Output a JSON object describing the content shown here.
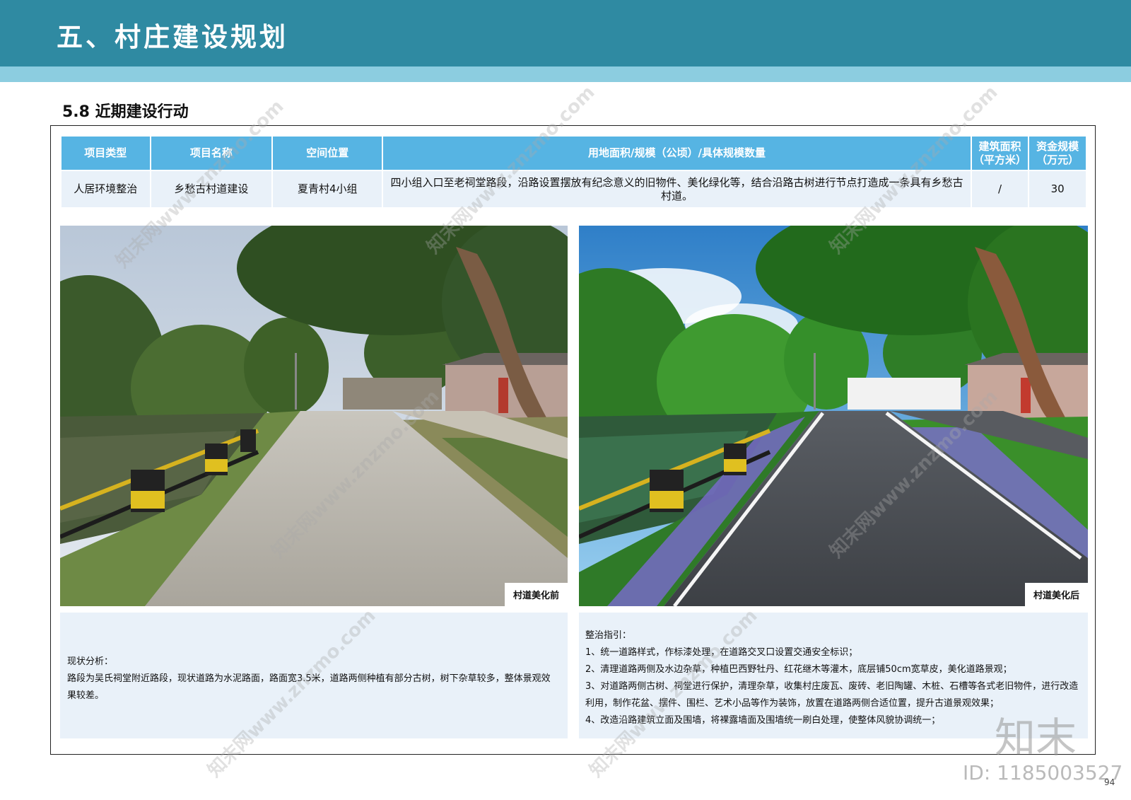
{
  "header": {
    "title": "五、村庄建设规划"
  },
  "section": {
    "title": "5.8 近期建设行动"
  },
  "table": {
    "headers": [
      "项目类型",
      "项目名称",
      "空间位置",
      "用地面积/规模（公顷）/具体规模数量",
      "建筑面积\n（平方米）",
      "资金规模\n（万元）"
    ],
    "rows": [
      [
        "人居环境整治",
        "乡愁古村道建设",
        "夏青村4小组",
        "四小组入口至老祠堂路段，沿路设置摆放有纪念意义的旧物件、美化绿化等，结合沿路古树进行节点打造成一条具有乡愁古村道。",
        "/",
        "30"
      ]
    ]
  },
  "photos": {
    "before_caption": "村道美化前",
    "after_caption": "村道美化后"
  },
  "analysis": {
    "heading": "现状分析：",
    "body": "路段为吴氏祠堂附近路段，现状道路为水泥路面，路面宽3.5米，道路两侧种植有部分古树，树下杂草较多，整体景观效果较差。"
  },
  "guide": {
    "heading": "整治指引：",
    "items": [
      "1、统一道路样式，作标漆处理，在道路交叉口设置交通安全标识；",
      "2、清理道路两侧及水边杂草，种植巴西野牡丹、红花继木等灌木，底层铺50cm宽草皮，美化道路景观；",
      "3、对道路两侧古树、祠堂进行保护，清理杂草，收集村庄废瓦、废砖、老旧陶罐、木桩、石槽等各式老旧物件，进行改造利用，制作花盆、摆件、围栏、艺术小品等作为装饰，放置在道路两侧合适位置，提升古道景观效果；",
      "4、改造沿路建筑立面及围墙，将裸露墙面及围墙统一刷白处理，使整体风貌协调统一；"
    ]
  },
  "watermark": {
    "site": "知末网www.znzmo.com",
    "logo": "知末",
    "id": "ID: 1185003527"
  },
  "page_number": "94",
  "colors": {
    "header": "#2f8aa2",
    "header_sub": "#8ccde0",
    "table_header": "#56b4e3",
    "cell_bg": "#e9f1f9"
  }
}
